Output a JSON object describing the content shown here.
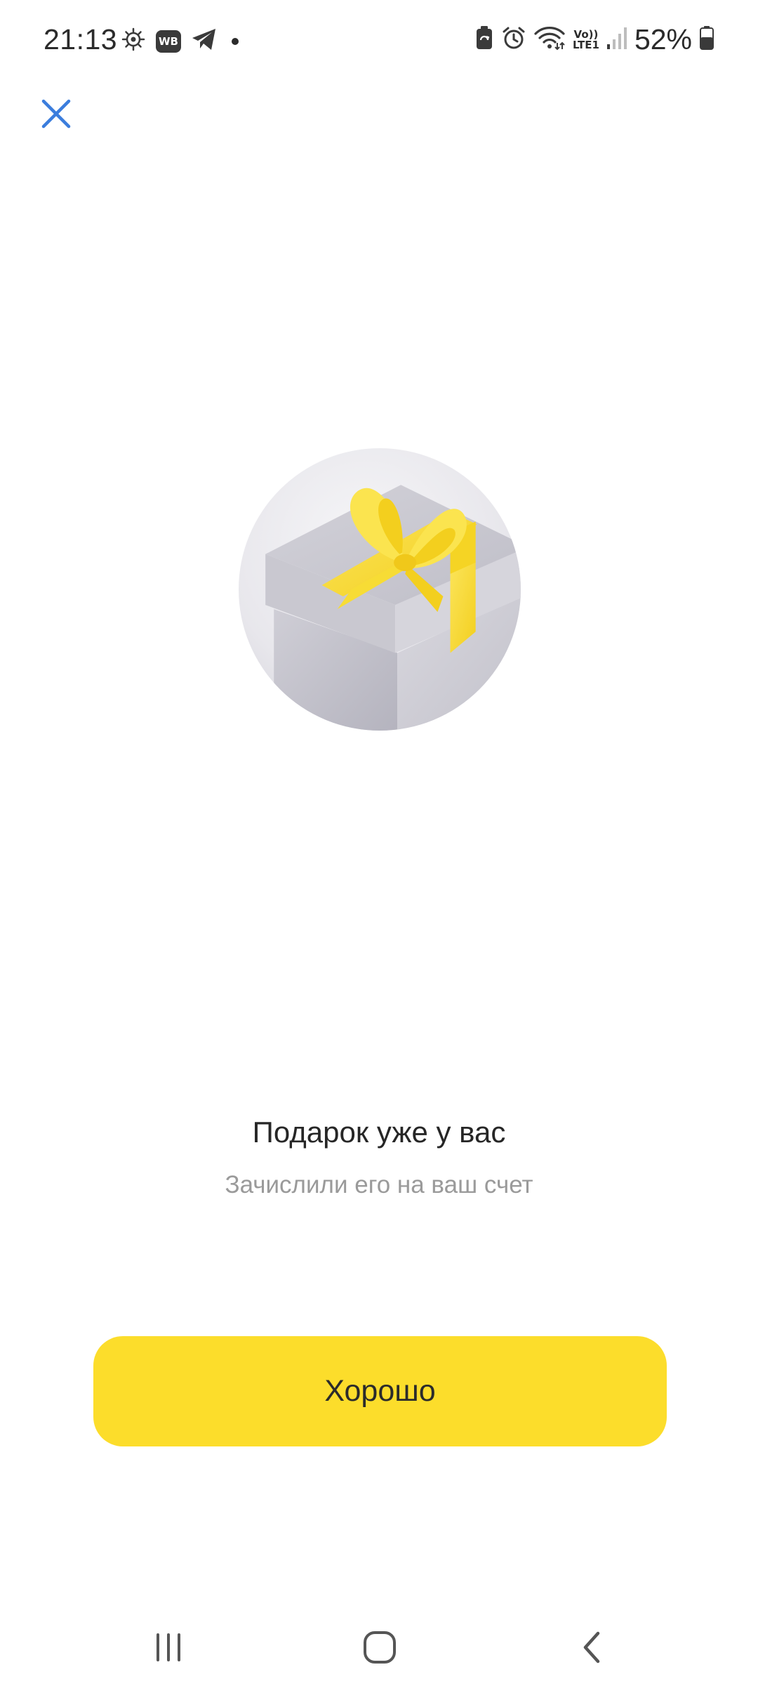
{
  "status_bar": {
    "time": "21:13",
    "wb_badge": "WB",
    "network_label": "Vo)) LTE1",
    "battery_percent": "52%",
    "icons": [
      "gear-bug-icon",
      "wb-app-icon",
      "telegram-icon",
      "notification-dot-icon",
      "battery-saver-icon",
      "alarm-icon",
      "wifi-icon",
      "lte-icon",
      "signal-icon",
      "battery-icon"
    ]
  },
  "header": {
    "close_icon": "close-icon",
    "accent_color": "#3b7ddd"
  },
  "illustration": {
    "icon": "gift-box-icon",
    "ribbon_color": "#f8d52c"
  },
  "message": {
    "title": "Подарок уже у вас",
    "subtitle": "Зачислили его на ваш счет"
  },
  "actions": {
    "ok_label": "Хорошо",
    "ok_color": "#fcdd2b"
  },
  "nav_bar": {
    "icons": [
      "recent-apps-icon",
      "home-icon",
      "back-icon"
    ]
  }
}
